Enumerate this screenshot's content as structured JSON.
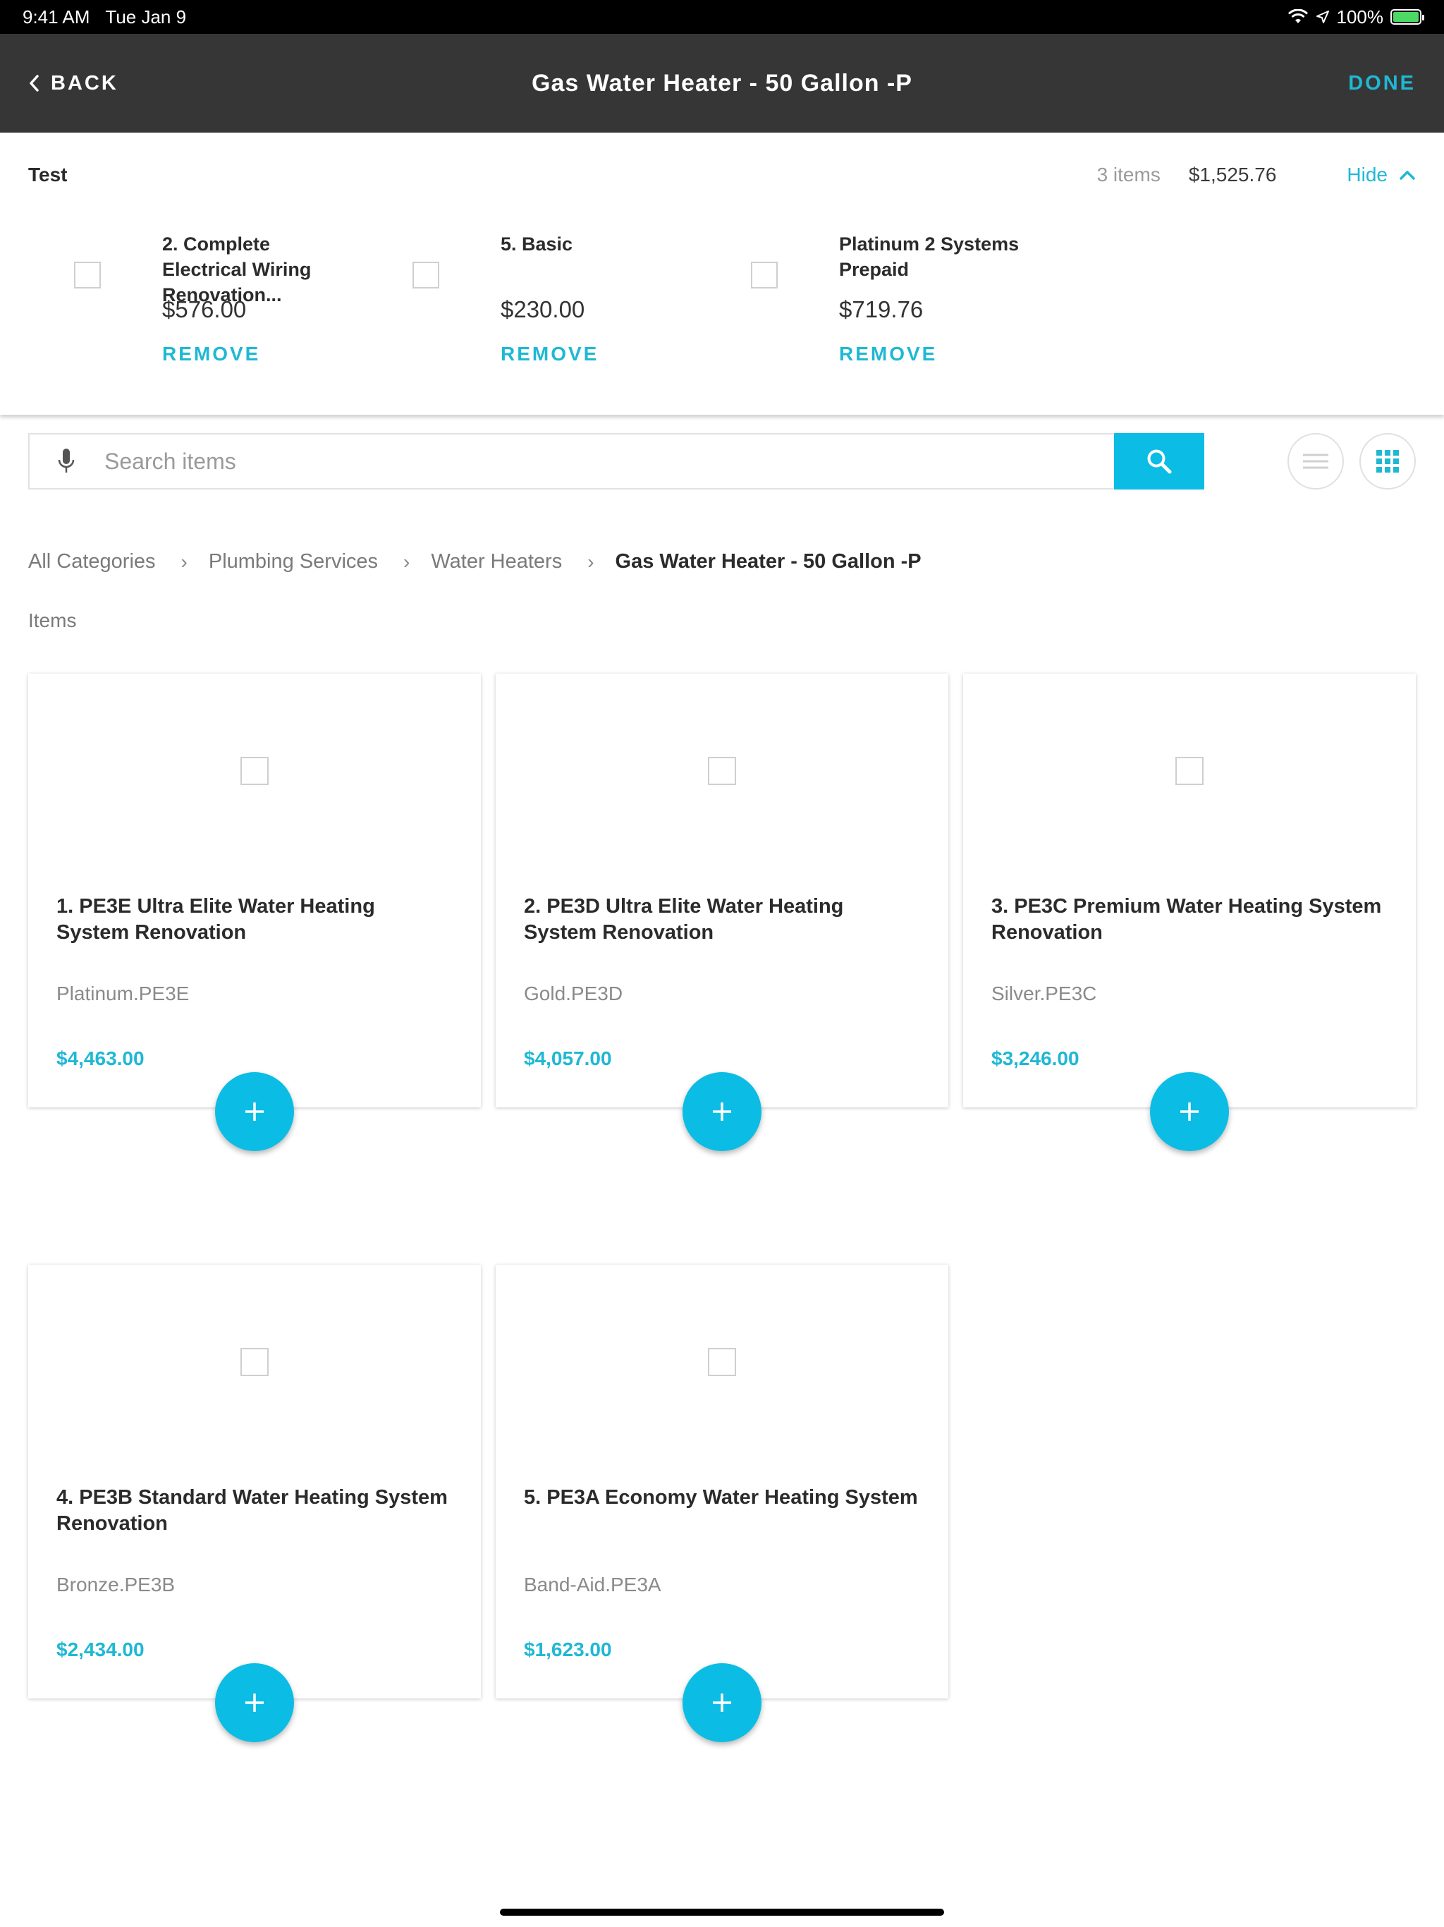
{
  "status_bar": {
    "time": "9:41 AM",
    "date": "Tue Jan 9",
    "battery": "100%"
  },
  "nav": {
    "back_label": "BACK",
    "title": "Gas Water Heater - 50 Gallon -P",
    "done_label": "DONE"
  },
  "selection": {
    "title": "Test",
    "count": "3 items",
    "total": "$1,525.76",
    "hide_label": "Hide",
    "items": [
      {
        "name": "2. Complete Electrical Wiring Renovation...",
        "price": "$576.00",
        "remove": "REMOVE"
      },
      {
        "name": "5. Basic",
        "price": "$230.00",
        "remove": "REMOVE"
      },
      {
        "name": "Platinum 2 Systems Prepaid",
        "price": "$719.76",
        "remove": "REMOVE"
      }
    ]
  },
  "search": {
    "placeholder": "Search items"
  },
  "breadcrumb": [
    "All Categories",
    "Plumbing Services",
    "Water Heaters",
    "Gas Water Heater - 50 Gallon -P"
  ],
  "section_label": "Items",
  "items": [
    {
      "title": "1. PE3E Ultra Elite Water Heating System Renovation",
      "code": "Platinum.PE3E",
      "price": "$4,463.00"
    },
    {
      "title": "2. PE3D Ultra Elite Water Heating System Renovation",
      "code": "Gold.PE3D",
      "price": "$4,057.00"
    },
    {
      "title": "3. PE3C Premium Water Heating System Renovation",
      "code": "Silver.PE3C",
      "price": "$3,246.00"
    },
    {
      "title": "4. PE3B Standard Water Heating System Renovation",
      "code": "Bronze.PE3B",
      "price": "$2,434.00"
    },
    {
      "title": "5. PE3A Economy Water Heating System",
      "code": "Band-Aid.PE3A",
      "price": "$1,623.00"
    }
  ],
  "icons": {
    "back": "chevron-left-icon",
    "hide": "chevron-up-icon",
    "mic": "microphone-icon",
    "search": "search-icon",
    "list_view": "list-view-icon",
    "grid_view": "grid-view-icon",
    "add": "plus-icon"
  },
  "colors": {
    "accent": "#1fb8d4",
    "button": "#0bbde4",
    "navbar": "#363636",
    "battery": "#4cd964"
  }
}
